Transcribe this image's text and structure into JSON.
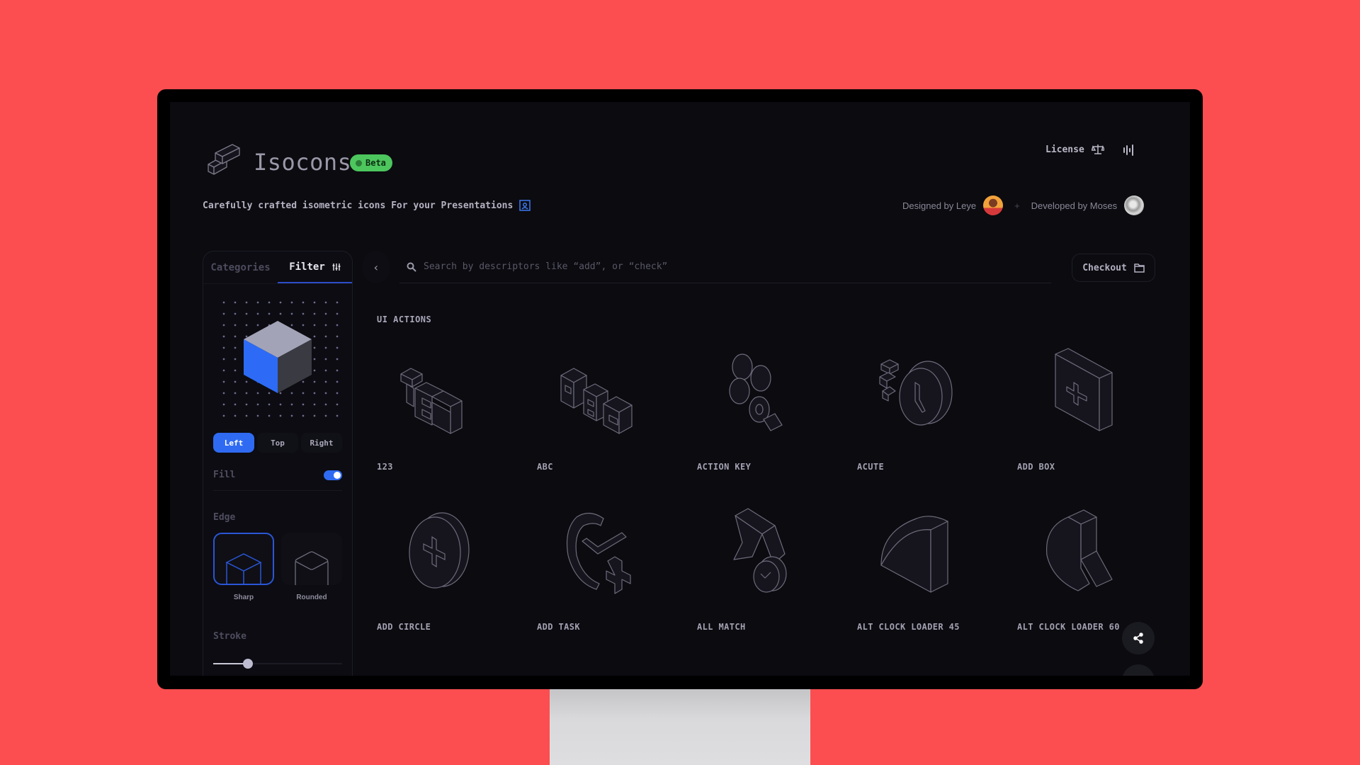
{
  "app": {
    "brand": "Isocons",
    "badge": "Beta",
    "tagline": "Carefully crafted isometric icons For your Presentations",
    "license_label": "License",
    "designed_by": "Designed by Leye",
    "separator": "+",
    "developed_by": "Developed by Moses"
  },
  "sidebar": {
    "tabs": [
      {
        "label": "Categories",
        "active": false
      },
      {
        "label": "Filter",
        "active": true
      }
    ],
    "views": [
      {
        "label": "Left",
        "active": true
      },
      {
        "label": "Top",
        "active": false
      },
      {
        "label": "Right",
        "active": false
      }
    ],
    "fill_label": "Fill",
    "fill_on": true,
    "edge_label": "Edge",
    "edges": [
      {
        "label": "Sharp",
        "active": true
      },
      {
        "label": "Rounded",
        "active": false
      }
    ],
    "stroke_label": "Stroke",
    "stroke_value_fraction": 0.27
  },
  "search": {
    "placeholder": "Search by descriptors like “add”, or “check”",
    "value": ""
  },
  "checkout_label": "Checkout",
  "section": {
    "title": "UI ACTIONS",
    "icons": [
      {
        "label": "123",
        "icon": "numbers-icon"
      },
      {
        "label": "ABC",
        "icon": "letters-icon"
      },
      {
        "label": "ACTION KEY",
        "icon": "action-key-icon"
      },
      {
        "label": "ACUTE",
        "icon": "acute-clock-icon"
      },
      {
        "label": "ADD BOX",
        "icon": "add-box-icon"
      },
      {
        "label": "ADD CIRCLE",
        "icon": "add-circle-icon"
      },
      {
        "label": "ADD TASK",
        "icon": "add-task-icon"
      },
      {
        "label": "ALL MATCH",
        "icon": "all-match-icon"
      },
      {
        "label": "ALT CLOCK LOADER 45",
        "icon": "clock-loader-45-icon"
      },
      {
        "label": "ALT CLOCK LOADER 60",
        "icon": "clock-loader-60-icon"
      }
    ]
  },
  "colors": {
    "background": "#fc4e50",
    "screen": "#0b0b10",
    "accent": "#2f6bf2",
    "beta_badge": "#4cc65d"
  }
}
